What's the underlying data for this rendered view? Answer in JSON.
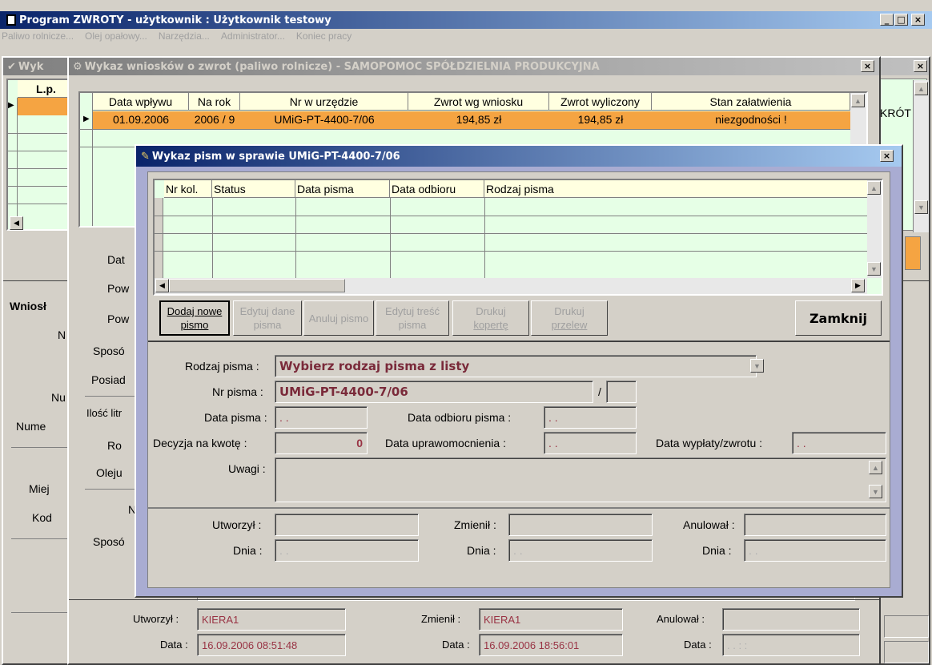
{
  "app": {
    "title": "Program ZWROTY - użytkownik : Użytkownik testowy",
    "menu": [
      "Paliwo rolnicze...",
      "Olej opałowy...",
      "Narzędzia...",
      "Administrator...",
      "Koniec pracy"
    ]
  },
  "win1": {
    "title": "Wyk",
    "header": [
      "L.p."
    ],
    "right_header": "KRÓT",
    "labels": [
      "Wniosł",
      "N",
      "Nu",
      "Nume",
      "Miej",
      "Kod"
    ]
  },
  "win2": {
    "title": "Wykaz wniosków o zwrot (paliwo rolnicze) - SAMOPOMOC SPÓŁDZIELNIA PRODUKCYJNA",
    "columns": [
      "Data wpływu",
      "Na rok",
      "Nr w urzędzie",
      "Zwrot wg wniosku",
      "Zwrot wyliczony",
      "Stan załatwienia"
    ],
    "row": [
      "01.09.2006",
      "2006 / 9",
      "UMiG-PT-4400-7/06",
      "194,85 zł",
      "194,85 zł",
      "niezgodności !"
    ],
    "labels": [
      "Dat",
      "Pow",
      "Pow",
      "Sposó",
      "Posiad",
      "Ilość litr",
      "Ro",
      "Oleju",
      "N",
      "Sposó"
    ],
    "footer": {
      "created_label": "Utworzył :",
      "created_value": "KIERA1",
      "created_date_label": "Data :",
      "created_date": "16.09.2006 08:51:48",
      "changed_label": "Zmienił :",
      "changed_value": "KIERA1",
      "changed_date_label": "Data :",
      "changed_date": "16.09.2006 18:56:01",
      "cancel_label": "Anulował :",
      "cancel_value": "",
      "cancel_date_label": "Data :",
      "cancel_date": " .  .      :  : "
    }
  },
  "dialog": {
    "title": "Wykaz pism w sprawie UMiG-PT-4400-7/06",
    "columns": [
      "Nr kol.",
      "Status",
      "Data pisma",
      "Data odbioru",
      "Rodzaj pisma"
    ],
    "buttons": {
      "add": [
        "Dodaj nowe",
        "pismo"
      ],
      "edit_data": [
        "Edytuj dane",
        "pisma"
      ],
      "cancel_letter": "Anuluj pismo",
      "edit_content": [
        "Edytuj treść",
        "pisma"
      ],
      "print_envelope": [
        "Drukuj",
        "kopertę"
      ],
      "print_transfer": [
        "Drukuj",
        "przelew"
      ],
      "close": "Zamknij"
    },
    "form": {
      "type_label": "Rodzaj pisma :",
      "type_value": "Wybierz rodzaj pisma z listy",
      "number_label": "Nr pisma :",
      "number_value": "UMiG-PT-4400-7/06",
      "slash": "/",
      "number_suffix": "",
      "date_label": "Data pisma :",
      "date_value": " .  . ",
      "receipt_label": "Data odbioru pisma :",
      "receipt_value": " .  . ",
      "decision_label": "Decyzja na kwotę :",
      "decision_value": "0",
      "validity_label": "Data uprawomocnienia :",
      "validity_value": " .  . ",
      "payout_label": "Data wypłaty/zwrotu :",
      "payout_value": " .  . ",
      "notes_label": "Uwagi :",
      "notes_value": "",
      "created_label": "Utworzył :",
      "created_value": "",
      "created_day_label": "Dnia :",
      "created_day": " .  . ",
      "changed_label": "Zmienił :",
      "changed_value": "",
      "changed_day_label": "Dnia :",
      "changed_day": " .  . ",
      "cancelled_label": "Anulował :",
      "cancelled_value": "",
      "cancelled_day_label": "Dnia :",
      "cancelled_day": " .  . "
    }
  },
  "colors": {
    "title_active": "#0a246a",
    "grid_header": "#ffffe0",
    "grid_body": "#e6ffe6",
    "selected_row": "#f5a442",
    "dialog_frame": "#a9acd2",
    "field_text": "#993344"
  }
}
